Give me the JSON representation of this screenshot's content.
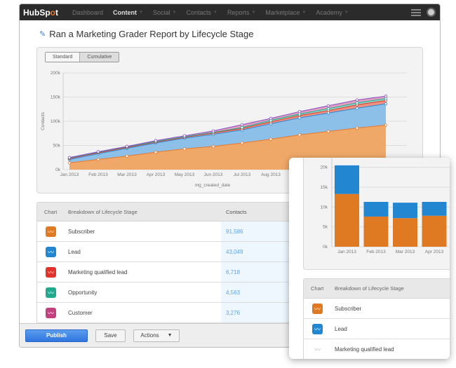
{
  "nav": {
    "logo": "HubSpot",
    "items": [
      {
        "label": "Dashboard",
        "active": false,
        "caret": false
      },
      {
        "label": "Content",
        "active": true,
        "caret": true
      },
      {
        "label": "Social",
        "active": false,
        "caret": true
      },
      {
        "label": "Contacts",
        "active": false,
        "caret": true
      },
      {
        "label": "Reports",
        "active": false,
        "caret": true
      },
      {
        "label": "Marketplace",
        "active": false,
        "caret": true
      },
      {
        "label": "Academy",
        "active": false,
        "caret": true
      }
    ],
    "menu_icon": "hamburger-icon",
    "avatar_icon": "user-avatar-icon"
  },
  "page": {
    "title": "Ran a Marketing Grader Report by Lifecycle Stage",
    "edit_icon": "pencil-icon"
  },
  "toggle": {
    "standard": "Standard",
    "cumulative": "Cumulative",
    "selected": "Cumulative"
  },
  "table": {
    "headers": {
      "chart": "Chart",
      "breakdown": "Breakdown of Lifecycle Stage",
      "contacts": "Contacts"
    },
    "rows": [
      {
        "label": "Subscriber",
        "value": "91,586",
        "color": "#e07a22"
      },
      {
        "label": "Lead",
        "value": "43,049",
        "color": "#2286d0"
      },
      {
        "label": "Marketing qualified lead",
        "value": "6,718",
        "color": "#e0342a"
      },
      {
        "label": "Opportunity",
        "value": "4,563",
        "color": "#21a98e"
      },
      {
        "label": "Customer",
        "value": "3,276",
        "color": "#c2407e"
      }
    ]
  },
  "footer": {
    "publish": "Publish",
    "save": "Save",
    "actions": "Actions"
  },
  "overlay_table": {
    "headers": {
      "chart": "Chart",
      "breakdown": "Breakdown of Lifecycle Stage"
    },
    "rows": [
      {
        "label": "Subscriber",
        "color": "#e07a22",
        "enabled": true
      },
      {
        "label": "Lead",
        "color": "#2286d0",
        "enabled": true
      },
      {
        "label": "Marketing qualified lead",
        "color": "#bbbbbb",
        "enabled": false
      }
    ]
  },
  "chart_data": [
    {
      "type": "area",
      "stacked": true,
      "xlabel": "mg_created_date",
      "ylabel": "Contacts",
      "ylim": [
        0,
        200000
      ],
      "yticks": [
        "0k",
        "50k",
        "100k",
        "150k",
        "200k"
      ],
      "x": [
        "Jan 2013",
        "Feb 2013",
        "Mar 2013",
        "Apr 2013",
        "May 2013",
        "Jun 2013",
        "Jul 2013",
        "Aug 2013",
        "Sep 2013",
        "Oct 2013",
        "Nov 2013",
        "Dec 2013"
      ],
      "xtick_labels": [
        "Jan 2013",
        "Feb 2013",
        "Mar 2013",
        "Apr 2013",
        "May 2013",
        "Jun 2013",
        "Jul 2013",
        "Aug 2013"
      ],
      "grid": true,
      "series": [
        {
          "name": "Subscriber",
          "color": "#f0a868",
          "line": "#e8782a",
          "values": [
            14000,
            21000,
            28000,
            36000,
            43000,
            48000,
            55000,
            63000,
            72000,
            79000,
            86000,
            92000
          ]
        },
        {
          "name": "Lead",
          "color": "#8cc0e8",
          "line": "#2a86d4",
          "values": [
            21000,
            33000,
            44000,
            55000,
            65000,
            73000,
            82000,
            95000,
            107000,
            117000,
            127000,
            136000
          ]
        },
        {
          "name": "Marketing qualified lead",
          "color": "#f09080",
          "line": "#e0342a",
          "values": [
            23000,
            35000,
            46000,
            57000,
            67000,
            76000,
            85000,
            99000,
            112000,
            122000,
            134000,
            143000
          ]
        },
        {
          "name": "Opportunity",
          "color": "#90d8c8",
          "line": "#21a98e",
          "values": [
            24000,
            36000,
            47000,
            58000,
            68000,
            77000,
            87000,
            102000,
            115000,
            126000,
            138000,
            147000
          ]
        },
        {
          "name": "Customer",
          "color": "#e0a0c0",
          "line": "#8a4cc8",
          "values": [
            25000,
            37000,
            48000,
            60000,
            70000,
            80000,
            93000,
            106000,
            120000,
            132000,
            144000,
            152000
          ]
        }
      ]
    },
    {
      "type": "bar",
      "stacked": true,
      "ylim": [
        0,
        25000
      ],
      "yticks": [
        "0k",
        "5k",
        "10k",
        "15k",
        "20k"
      ],
      "categories": [
        "Jan 2013",
        "Feb 2013",
        "Mar 2013",
        "Apr 2013"
      ],
      "grid": true,
      "series": [
        {
          "name": "Subscriber",
          "color": "#e07a22",
          "values": [
            13300,
            7600,
            7200,
            7800
          ]
        },
        {
          "name": "Lead",
          "color": "#2286d0",
          "values": [
            7200,
            3700,
            3900,
            3500
          ]
        }
      ]
    }
  ]
}
